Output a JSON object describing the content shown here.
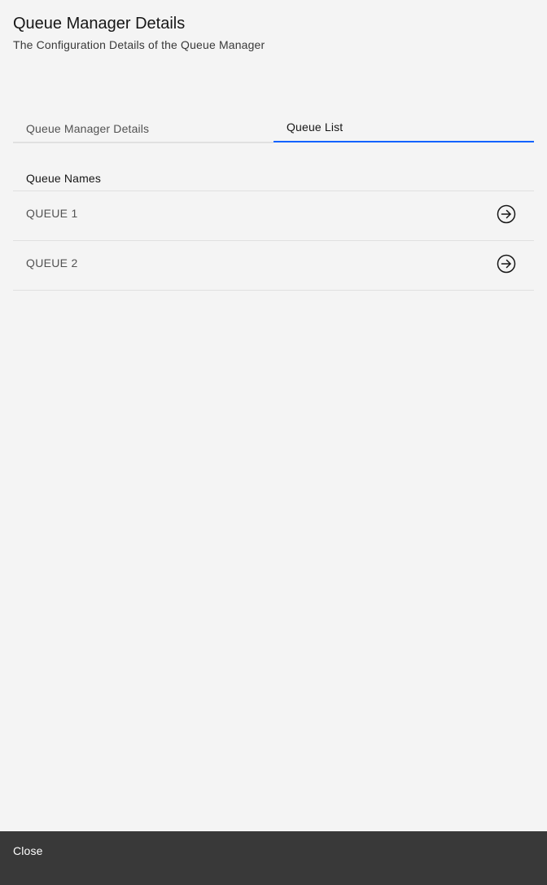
{
  "header": {
    "title": "Queue Manager Details",
    "subtitle": "The Configuration Details of the Queue Manager"
  },
  "tabs": [
    {
      "label": "Queue Manager Details",
      "active": false
    },
    {
      "label": "Queue List",
      "active": true
    }
  ],
  "queue_list": {
    "column_header": "Queue Names",
    "rows": [
      {
        "name": "QUEUE 1",
        "action_icon": "arrow-right-circle-icon"
      },
      {
        "name": "QUEUE 2",
        "action_icon": "arrow-right-circle-icon"
      }
    ]
  },
  "footer": {
    "close_label": "Close"
  },
  "colors": {
    "background": "#f4f4f4",
    "tab_active_underline": "#0f62fe",
    "footer_background": "#393939",
    "divider": "#e0e0e0"
  }
}
